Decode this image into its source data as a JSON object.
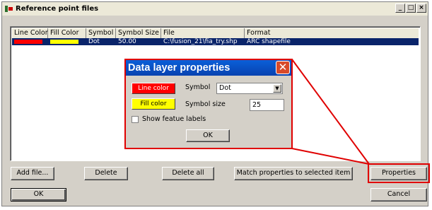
{
  "window": {
    "title": "Reference point files",
    "buttons": [
      "_",
      "□",
      "×"
    ]
  },
  "list": {
    "columns": [
      "Line Color",
      "Fill Color",
      "Symbol",
      "Symbol Size",
      "File",
      "Format"
    ],
    "rows": [
      {
        "line_color": "#ff0000",
        "fill_color": "#ffff00",
        "symbol": "Dot",
        "symbol_size": "50.00",
        "file": "C:\\fusion_21\\fia_try.shp",
        "format": "ARC shapefile",
        "selected": true
      }
    ]
  },
  "buttons": {
    "add_file": "Add file...",
    "delete": "Delete",
    "delete_all": "Delete all",
    "match": "Match properties to selected item",
    "properties": "Properties",
    "ok": "OK",
    "cancel": "Cancel"
  },
  "dialog": {
    "title": "Data layer properties",
    "close_glyph": "✕",
    "line_color_label": "Line color",
    "line_color": "#ff0000",
    "fill_color_label": "Fill color",
    "fill_color": "#ffff00",
    "symbol_label": "Symbol",
    "symbol_value": "Dot",
    "symbol_size_label": "Symbol size",
    "symbol_size_value": "25",
    "show_labels_label": "Show featue labels",
    "show_labels_checked": false,
    "ok_label": "OK"
  },
  "colors": {
    "highlight": "#e00000",
    "selection": "#0a246a"
  }
}
